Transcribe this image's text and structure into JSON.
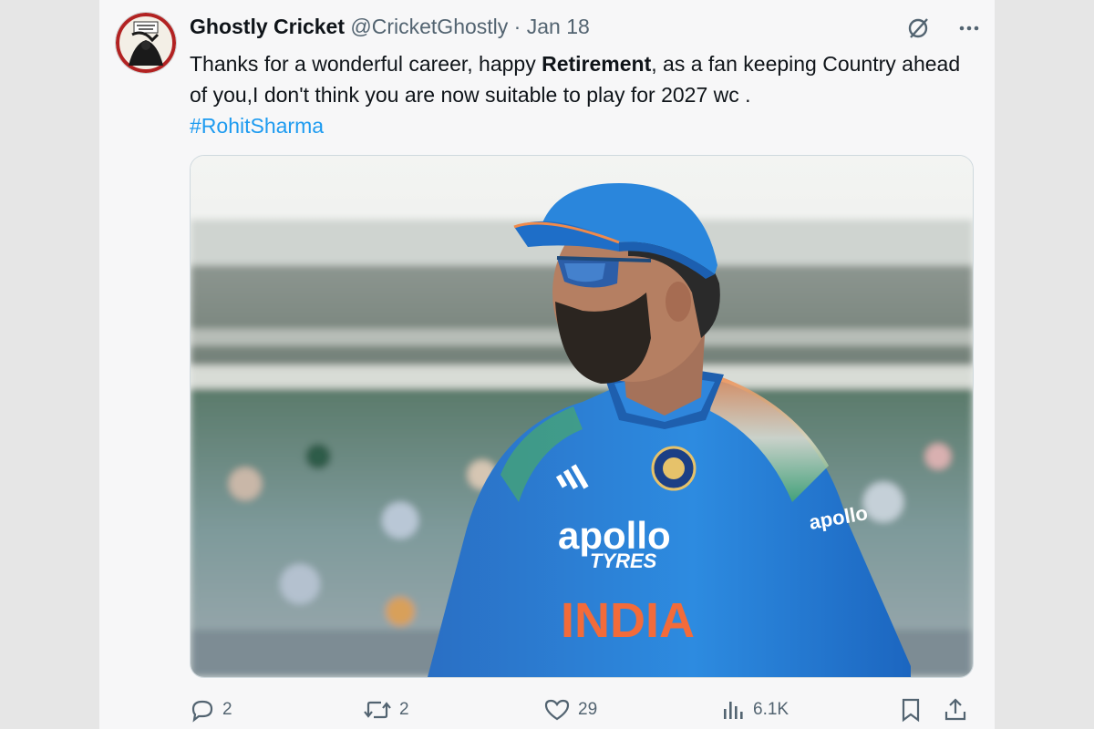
{
  "tweet": {
    "author_name": "Ghostly Cricket",
    "handle": "@CricketGhostly",
    "separator": "·",
    "date": "Jan 18",
    "text_part1": "Thanks for a wonderful career, happy ",
    "text_bold": "Retirement",
    "text_part2": ", as a fan keeping Country ahead of you,I don't think you are now suitable to play for 2027 wc .",
    "hashtag": "#RohitSharma",
    "avatar_label": "Ghostly Cricket",
    "media": {
      "jersey_brand": "apollo",
      "jersey_sponsor_sub": "TYRES",
      "jersey_country": "INDIA",
      "sleeve_text": "apollo"
    }
  },
  "actions": {
    "reply_count": "2",
    "retweet_count": "2",
    "like_count": "29",
    "views_count": "6.1K"
  },
  "icons": {
    "top": [
      "grok-icon",
      "more-icon"
    ],
    "bottom": [
      "reply-icon",
      "retweet-icon",
      "like-icon",
      "views-icon",
      "bookmark-icon",
      "share-icon"
    ]
  },
  "colors": {
    "link": "#1d9bf0",
    "muted": "#536471",
    "jersey_blue": "#1f7fd6"
  }
}
